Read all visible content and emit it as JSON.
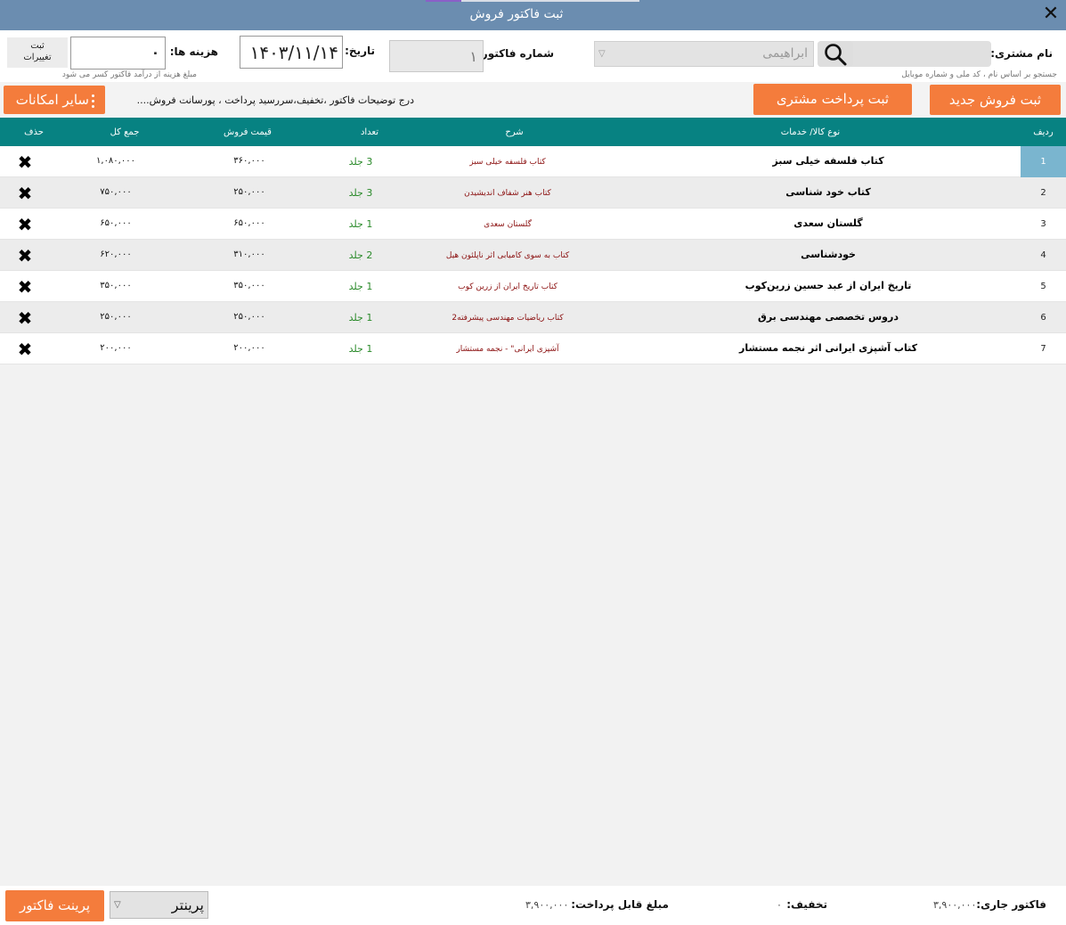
{
  "window": {
    "title": "ثبت فاکتور فروش",
    "close_glyph": "✕"
  },
  "header": {
    "customer_label": "نام مشتری:",
    "customer_value": "ابراهیمی",
    "customer_hint": "جستجو بر اساس نام ، کد ملی و شماره موبایل",
    "invoice_no_label": "شماره فاکتور:",
    "invoice_no_value": "۱",
    "date_label": "تاریخ:",
    "date_value": "۱۴۰۳/۱۱/۱۴",
    "cost_label": "هزینه ها:",
    "cost_value": "۰",
    "cost_hint": "مبلغ هزینه از درآمد فاکتور کسر می شود",
    "save_changes_line1": "ثبت",
    "save_changes_line2": "تغییرات"
  },
  "actions": {
    "new_sale": "ثبت فروش جدید",
    "customer_payment": "ثبت پرداخت مشتری",
    "description": "درج توضیحات فاکتور ،تخفیف،سررسید پرداخت ، پورسانت فروش....",
    "more_options": "سایر امکانات"
  },
  "table": {
    "columns": {
      "row": "ردیف",
      "item_type": "نوع کالا/ خدمات",
      "description": "شرح",
      "quantity": "تعداد",
      "unit_price": "قیمت فروش",
      "total": "جمع کل",
      "delete": "حذف"
    },
    "delete_glyph": "✖",
    "rows": [
      {
        "n": "1",
        "item": "کتاب فلسفه خیلی سبز",
        "desc": "کتاب فلسفه خیلی سبز",
        "qty": "3 جلد",
        "price": "۳۶۰,۰۰۰",
        "total": "۱,۰۸۰,۰۰۰"
      },
      {
        "n": "2",
        "item": "کتاب خود شناسی",
        "desc": "کتاب هنر شفاف اندیشیدن",
        "qty": "3 جلد",
        "price": "۲۵۰,۰۰۰",
        "total": "۷۵۰,۰۰۰"
      },
      {
        "n": "3",
        "item": "گلستان سعدی",
        "desc": "گلستان سعدی",
        "qty": "1 جلد",
        "price": "۶۵۰,۰۰۰",
        "total": "۶۵۰,۰۰۰"
      },
      {
        "n": "4",
        "item": "خودشناسی",
        "desc": "کتاب به سوی کامیابی اثر ناپلئون هیل",
        "qty": "2 جلد",
        "price": "۳۱۰,۰۰۰",
        "total": "۶۲۰,۰۰۰"
      },
      {
        "n": "5",
        "item": "تاریخ ایران از عبد حسین زرین‌کوب",
        "desc": "کتاب تاریخ ایران از زرین کوب",
        "qty": "1 جلد",
        "price": "۳۵۰,۰۰۰",
        "total": "۳۵۰,۰۰۰"
      },
      {
        "n": "6",
        "item": "دروس تخصصی مهندسی برق",
        "desc": "کتاب ریاضیات مهندسی پیشرفته2",
        "qty": "1 جلد",
        "price": "۲۵۰,۰۰۰",
        "total": "۲۵۰,۰۰۰"
      },
      {
        "n": "7",
        "item": "کتاب آشپزی ایرانی اثر نجمه مستشار",
        "desc": "آشپزی ایرانی\" - نجمه مستشار",
        "qty": "1 جلد",
        "price": "۲۰۰,۰۰۰",
        "total": "۲۰۰,۰۰۰"
      }
    ]
  },
  "footer": {
    "current_invoice_label": "فاکتور جاری:",
    "current_invoice_value": "۳,۹۰۰,۰۰۰",
    "discount_label": "تخفیف:",
    "discount_value": "۰",
    "payable_label": "مبلغ قابل پرداخت:",
    "payable_value": "۳,۹۰۰,۰۰۰",
    "printer_value": "پرینتر",
    "print_button": "پرینت فاکتور"
  },
  "colors": {
    "titlebar": "#6b8db0",
    "table_header": "#078282",
    "orange_button": "#f47c3c",
    "selected_row": "#7ab5cf"
  }
}
